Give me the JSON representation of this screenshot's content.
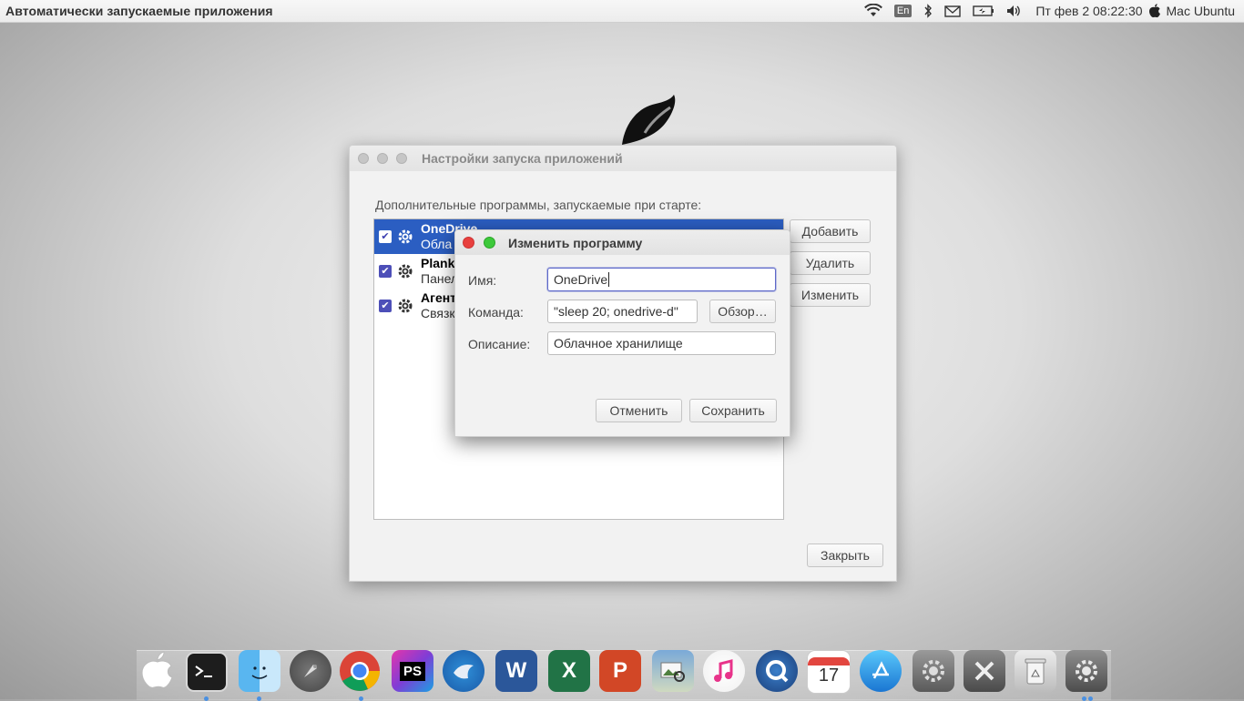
{
  "topbar": {
    "app_title": "Автоматически запускаемые приложения",
    "lang": "En",
    "clock": "Пт фев  2 08:22:30",
    "user": "Mac Ubuntu",
    "icons": [
      "wifi-icon",
      "keyboard-language-icon",
      "bluetooth-icon",
      "mail-icon",
      "battery-icon",
      "volume-icon",
      "apple-menu-icon"
    ]
  },
  "main_window": {
    "title": "Настройки запуска приложений",
    "label": "Дополнительные программы, запускаемые при старте:",
    "items": [
      {
        "name": "OneDrive",
        "desc": "Обла",
        "checked": true,
        "selected": true
      },
      {
        "name": "Plank",
        "desc": "Панел",
        "checked": true,
        "selected": false
      },
      {
        "name": "Агент",
        "desc": "Связк",
        "checked": true,
        "selected": false
      }
    ],
    "add_label": "Добавить",
    "remove_label": "Удалить",
    "edit_label": "Изменить",
    "close_label": "Закрыть"
  },
  "dialog": {
    "title": "Изменить программу",
    "name_label": "Имя:",
    "name_value": "OneDrive",
    "command_label": "Команда:",
    "command_value": "\"sleep 20; onedrive-d\"",
    "browse_label": "Обзор…",
    "description_label": "Описание:",
    "description_value": "Облачное хранилище",
    "cancel_label": "Отменить",
    "save_label": "Сохранить"
  },
  "dock": {
    "items": [
      {
        "name": "apple-dock-icon",
        "label": ""
      },
      {
        "name": "terminal-icon",
        "label": ""
      },
      {
        "name": "finder-icon",
        "label": ""
      },
      {
        "name": "launchpad-icon",
        "label": ""
      },
      {
        "name": "chrome-icon",
        "label": ""
      },
      {
        "name": "phpstorm-icon",
        "label": "PS"
      },
      {
        "name": "thunderbird-icon",
        "label": ""
      },
      {
        "name": "word-icon",
        "label": "W"
      },
      {
        "name": "excel-icon",
        "label": "X"
      },
      {
        "name": "powerpoint-icon",
        "label": "P"
      },
      {
        "name": "image-viewer-icon",
        "label": ""
      },
      {
        "name": "itunes-icon",
        "label": ""
      },
      {
        "name": "quicktime-icon",
        "label": ""
      },
      {
        "name": "calendar-icon",
        "label": "17"
      },
      {
        "name": "app-store-icon",
        "label": ""
      },
      {
        "name": "system-preferences-icon",
        "label": ""
      },
      {
        "name": "tools-icon",
        "label": ""
      },
      {
        "name": "trash-icon",
        "label": ""
      },
      {
        "name": "settings-icon",
        "label": ""
      }
    ]
  }
}
